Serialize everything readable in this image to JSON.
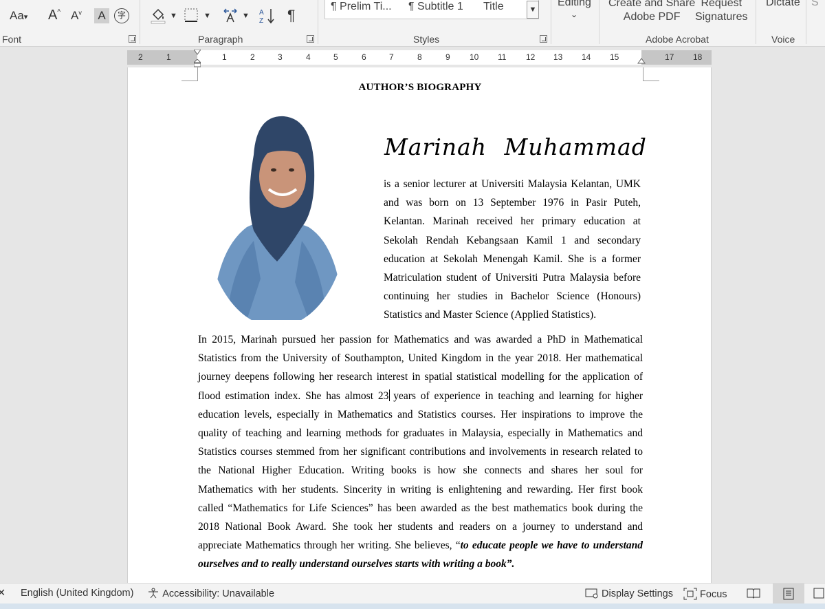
{
  "ribbon": {
    "groups": {
      "font": "Font",
      "paragraph": "Paragraph",
      "styles": "Styles",
      "adobe": "Adobe Acrobat",
      "voice": "Voice"
    },
    "font_buttons": {
      "change_case": "Aa",
      "grow": "A",
      "shrink": "A",
      "highlight": "A"
    },
    "styles": [
      "¶ Prelim Ti...",
      "¶ Subtitle 1",
      "Title"
    ],
    "editing_label": "Editing",
    "adobe_create": [
      "Create and Share",
      "Adobe PDF"
    ],
    "adobe_request": [
      "Request",
      "Signatures"
    ],
    "dictate": "Dictate"
  },
  "ruler": {
    "ticks": [
      "2",
      "1",
      "1",
      "2",
      "3",
      "4",
      "5",
      "6",
      "7",
      "8",
      "9",
      "10",
      "11",
      "12",
      "13",
      "14",
      "15",
      "17",
      "18"
    ]
  },
  "document": {
    "heading": "AUTHOR’S BIOGRAPHY",
    "author_name": "Marinah  Muhammad",
    "intro_lines": [
      "is a senior lecturer at Universiti Malaysia Kelantan, UMK",
      "and was born on 13 September 1976 in Pasir Puteh,",
      "Kelantan. Marinah received her primary education at",
      "Sekolah Rendah Kebangsaan Kamil 1 and secondary",
      "education at Sekolah Menengah Kamil.  She is a former",
      "Matriculation student of Universiti Putra Malaysia before",
      "continuing her studies in Bachelor Science (Honours)",
      "Statistics and Master Science (Applied Statistics)."
    ],
    "main_lines": [
      "In 2015, Marinah pursued her passion for Mathematics and was awarded a PhD in Mathematical",
      "Statistics from the University of Southampton, United Kingdom in the year 2018. Her mathematical",
      "journey deepens following her research interest in spatial statistical modelling for the application of",
      "flood estimation index. She has almost 23 years of experience in teaching and learning for higher",
      "education levels, especially in Mathematics and Statistics courses. Her inspirations to improve the",
      "quality of teaching and learning methods for graduates in Malaysia, especially in Mathematics and",
      "Statistics courses stemmed from her significant contributions and involvements in research related to",
      "the National Higher Education. Writing books is how she connects and shares her soul for",
      "Mathematics with her students. Sincerity in writing is enlightening and rewarding. Her first book",
      "called “Mathematics for Life Sciences” has been awarded as the best mathematics book during the",
      "2018 National Book Award. She took her students and readers on a journey to understand and"
    ],
    "line12_plain": "appreciate Mathematics through her writing. She believes, “",
    "line12_quote": "to educate people we have to understand",
    "line13_quote": "ourselves and to really understand ourselves starts with writing a book”."
  },
  "statusbar": {
    "language": "English (United Kingdom)",
    "accessibility": "Accessibility: Unavailable",
    "display_settings": "Display Settings",
    "focus": "Focus"
  }
}
